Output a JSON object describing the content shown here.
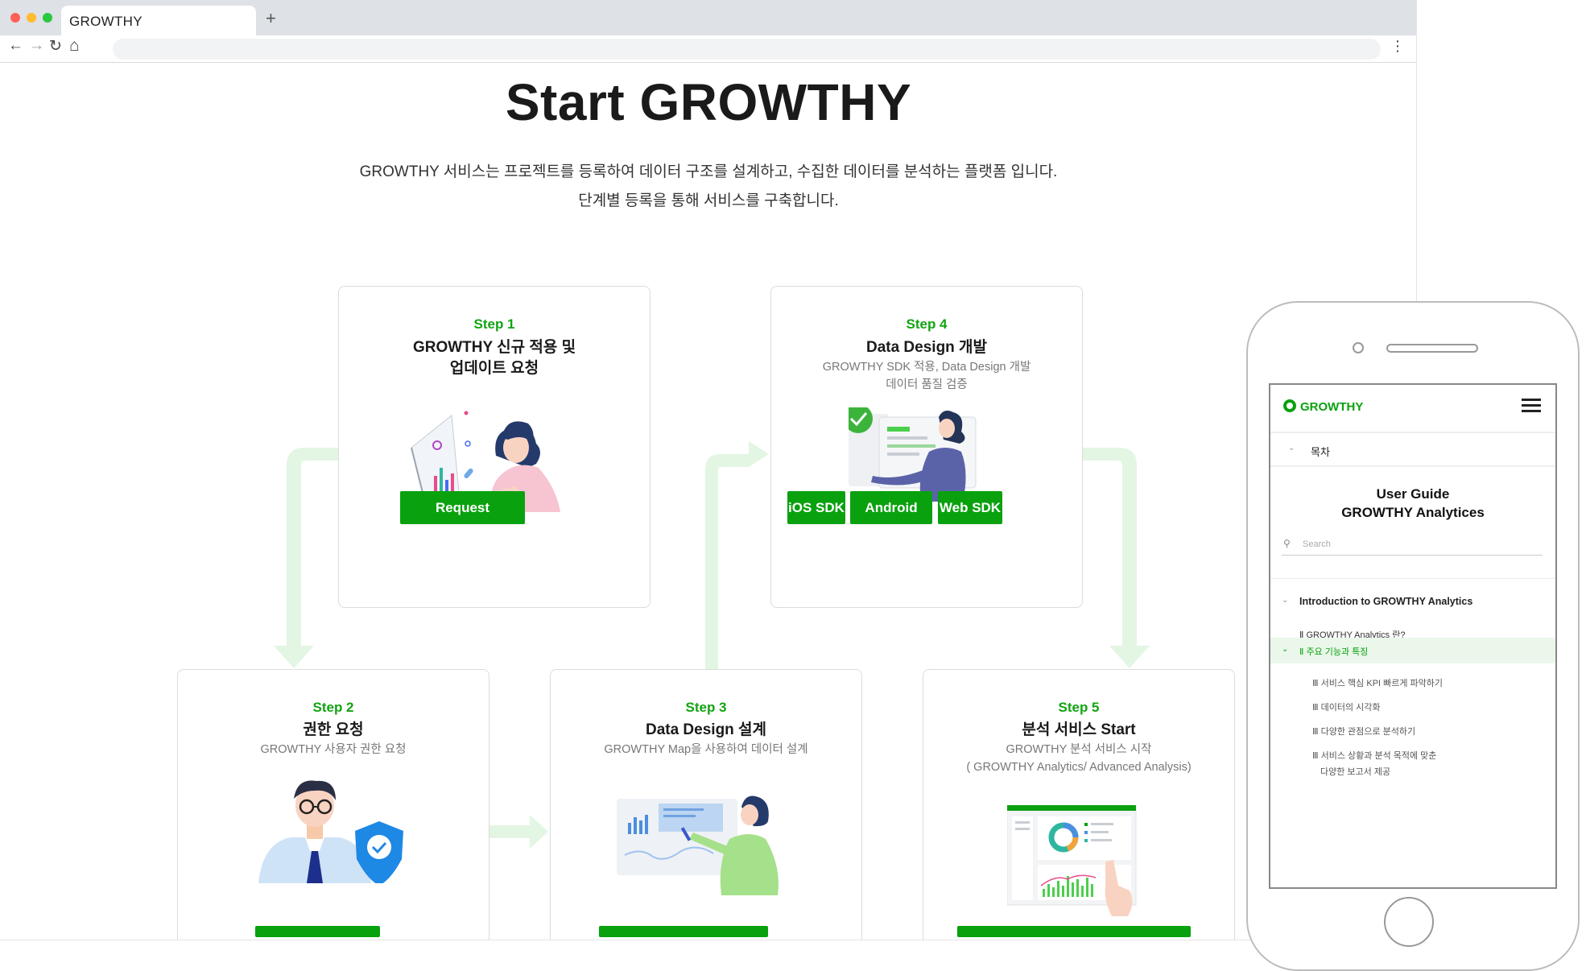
{
  "browser": {
    "tab_title": "GROWTHY",
    "new_tab": "+",
    "nav": {
      "back": "←",
      "forward": "→",
      "reload": "↻",
      "home": "⌂",
      "menu": "⋮"
    }
  },
  "hero": {
    "title": "Start GROWTHY",
    "desc_line1": "GROWTHY 서비스는 프로젝트를 등록하여 데이터 구조를 설계하고, 수집한 데이터를 분석하는 플랫폼 입니다.",
    "desc_line2": "단계별 등록을 통해 서비스를 구축합니다."
  },
  "steps": {
    "step1": {
      "label": "Step 1",
      "title1": "GROWTHY 신규 적용 및",
      "title2": "업데이트 요청",
      "button": "Request"
    },
    "step2": {
      "label": "Step 2",
      "title": "권한 요청",
      "sub": "GROWTHY 사용자 권한 요청"
    },
    "step3": {
      "label": "Step 3",
      "title": "Data Design 설계",
      "sub": "GROWTHY Map을 사용하여 데이터 설계"
    },
    "step4": {
      "label": "Step 4",
      "title": "Data Design 개발",
      "sub1": "GROWTHY SDK 적용, Data Design 개발",
      "sub2": "데이터 품질 검증",
      "buttons": [
        "iOS SDK",
        "Android SDK",
        "Web SDK"
      ]
    },
    "step5": {
      "label": "Step 5",
      "title": "분석 서비스 Start",
      "sub1": "GROWTHY 분석 서비스 시작",
      "sub2": "( GROWTHY Analytics/ Advanced Analysis)"
    }
  },
  "phone": {
    "logo": "GROWTHY",
    "toc": "목차",
    "guide_line1": "User Guide",
    "guide_line2": "GROWTHY Analytices",
    "search_placeholder": "Search",
    "section": "Introduction to GROWTHY Analytics",
    "items": [
      "Ⅱ GROWTHY Analytics 란?",
      "Ⅱ 주요 기능과 특징",
      "Ⅲ 서비스 핵심 KPI 빠르게 파악하기",
      "Ⅲ 데이터의 시각화",
      "Ⅲ 다양한 관점으로 분석하기",
      "Ⅲ 서비스 상황과 분석 목적에 맞춘",
      "다양한 보고서 제공"
    ]
  },
  "colors": {
    "accent": "#0aa10f",
    "step_label": "#12a312",
    "arrow": "#e3f5e3"
  }
}
